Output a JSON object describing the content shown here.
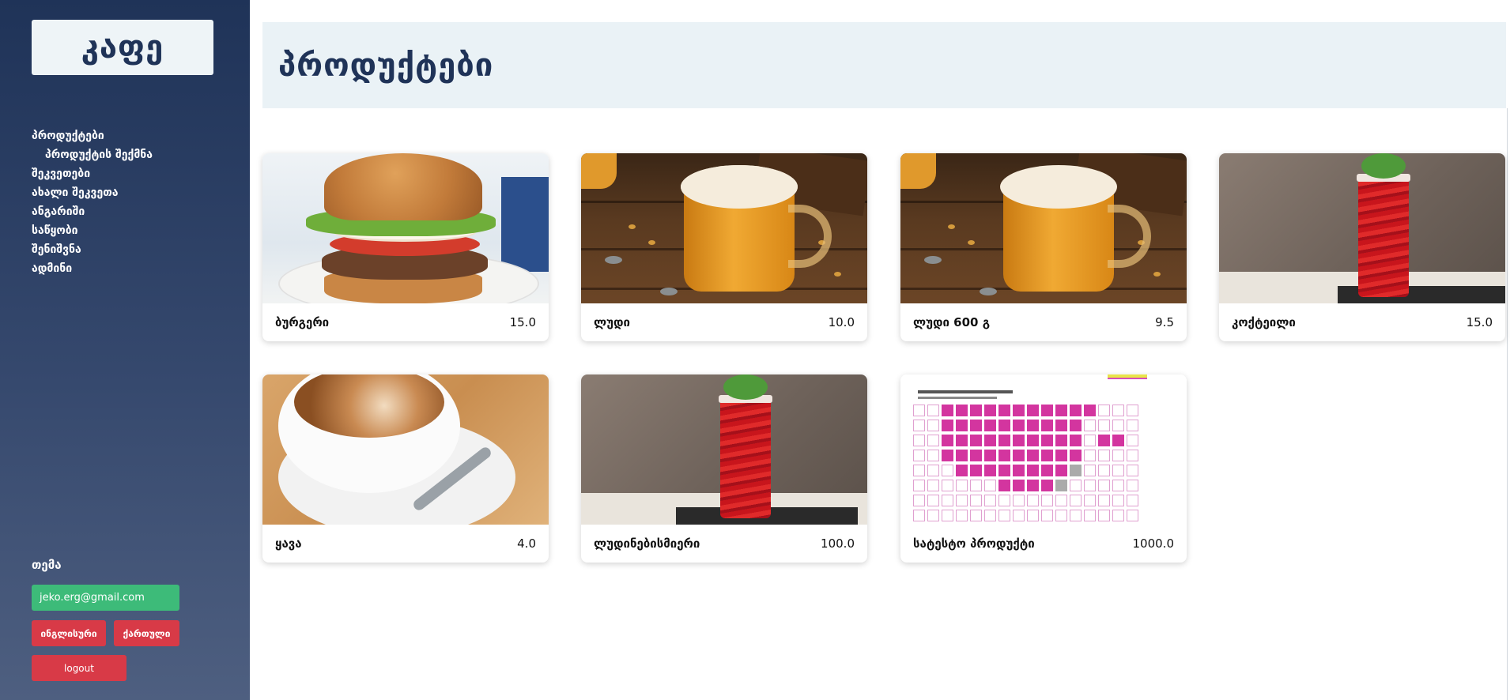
{
  "sidebar": {
    "logo": "კაფე",
    "nav": [
      {
        "label": "პროდუქტები",
        "sub": false
      },
      {
        "label": "პროდუქტის შექმნა",
        "sub": true
      },
      {
        "label": "შეკვეთები",
        "sub": false
      },
      {
        "label": "ახალი შეკვეთა",
        "sub": false
      },
      {
        "label": "ანგარიში",
        "sub": false
      },
      {
        "label": "საწყობი",
        "sub": false
      },
      {
        "label": "შენიშვნა",
        "sub": false
      },
      {
        "label": "ადმინი",
        "sub": false
      }
    ],
    "theme_label": "თემა",
    "email": "jeko.erg@gmail.com",
    "lang_en": "ინგლისური",
    "lang_ka": "ქართული",
    "logout": "logout"
  },
  "main": {
    "title": "პროდუქტები",
    "products": [
      {
        "name": "ბურგერი",
        "price": "15.0",
        "image": "burger"
      },
      {
        "name": "ლუდი",
        "price": "10.0",
        "image": "beer"
      },
      {
        "name": "ლუდი 600 გ",
        "price": "9.5",
        "image": "beer"
      },
      {
        "name": "კოქტეილი",
        "price": "15.0",
        "image": "cocktail"
      },
      {
        "name": "ყავა",
        "price": "4.0",
        "image": "coffee"
      },
      {
        "name": "ლუდინებისმიერი",
        "price": "100.0",
        "image": "cocktail"
      },
      {
        "name": "სატესტო პროდუქტი",
        "price": "1000.0",
        "image": "calendar-screenshot"
      }
    ]
  },
  "colors": {
    "sidebar_top": "#1f3358",
    "header_bg": "#eaf2f6",
    "title": "#1f3358",
    "email_button": "#3dbb79",
    "danger_button": "#d83a47"
  }
}
